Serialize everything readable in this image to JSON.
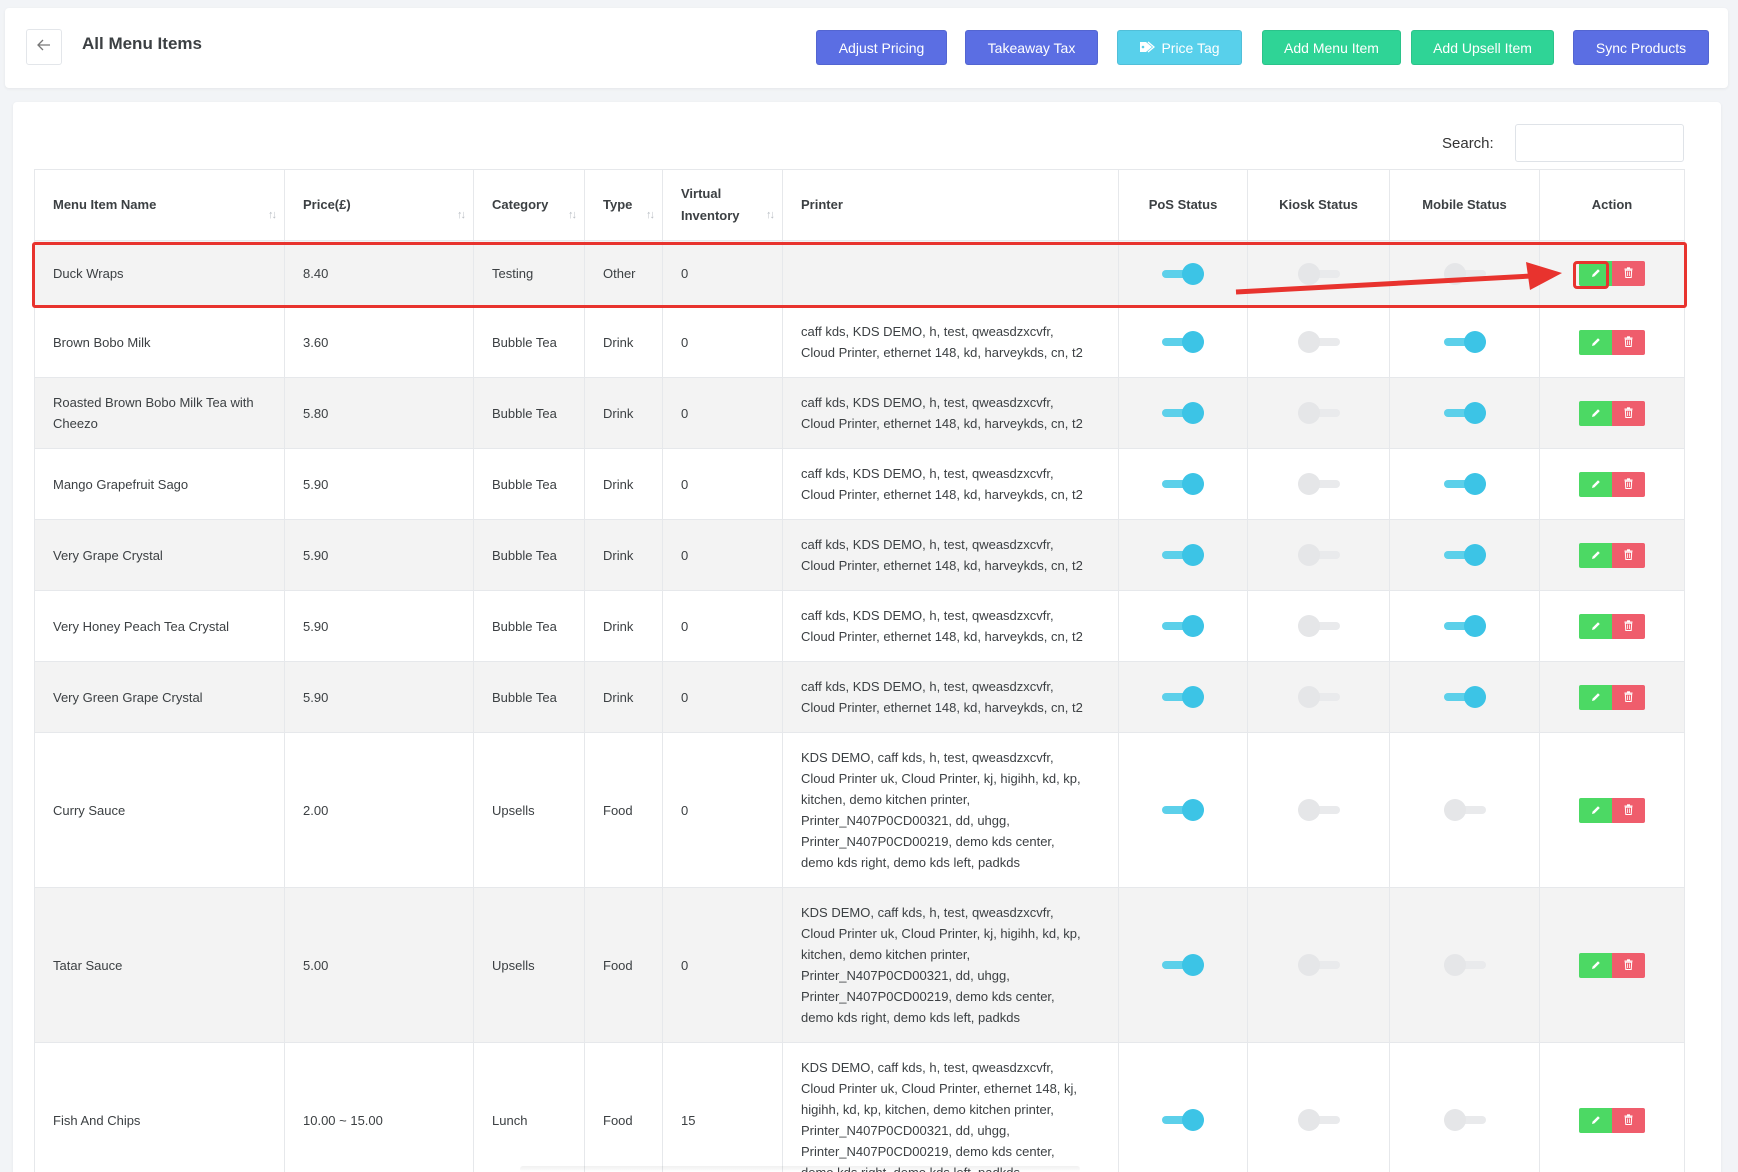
{
  "header": {
    "title": "All Menu Items",
    "buttons": {
      "adjust_pricing": "Adjust Pricing",
      "takeaway_tax": "Takeaway Tax",
      "price_tag": "Price Tag",
      "add_menu_item": "Add Menu Item",
      "add_upsell_item": "Add Upsell Item",
      "sync_products": "Sync Products"
    }
  },
  "search": {
    "label": "Search:",
    "value": ""
  },
  "table": {
    "columns": {
      "name": "Menu Item Name",
      "price": "Price(£)",
      "category": "Category",
      "type": "Type",
      "inventory": "Virtual Inventory",
      "printer": "Printer",
      "pos_status": "PoS Status",
      "kiosk_status": "Kiosk Status",
      "mobile_status": "Mobile Status",
      "action": "Action"
    },
    "rows": [
      {
        "name": "Duck Wraps",
        "price": "8.40",
        "category": "Testing",
        "type": "Other",
        "inventory": "0",
        "printer": [],
        "pos": true,
        "kiosk": false,
        "mobile": false
      },
      {
        "name": "Brown Bobo Milk",
        "price": "3.60",
        "category": "Bubble Tea",
        "type": "Drink",
        "inventory": "0",
        "printer": [
          "caff kds, KDS DEMO, h, test, qweasdzxcvfr,",
          "Cloud Printer, ethernet 148, kd, harveykds, cn, t2"
        ],
        "pos": true,
        "kiosk": false,
        "mobile": true
      },
      {
        "name": "Roasted Brown Bobo Milk Tea with Cheezo",
        "price": "5.80",
        "category": "Bubble Tea",
        "type": "Drink",
        "inventory": "0",
        "printer": [
          "caff kds, KDS DEMO, h, test, qweasdzxcvfr,",
          "Cloud Printer, ethernet 148, kd, harveykds, cn, t2"
        ],
        "pos": true,
        "kiosk": false,
        "mobile": true
      },
      {
        "name": "Mango Grapefruit Sago",
        "price": "5.90",
        "category": "Bubble Tea",
        "type": "Drink",
        "inventory": "0",
        "printer": [
          "caff kds, KDS DEMO, h, test, qweasdzxcvfr,",
          "Cloud Printer, ethernet 148, kd, harveykds, cn, t2"
        ],
        "pos": true,
        "kiosk": false,
        "mobile": true
      },
      {
        "name": "Very Grape Crystal",
        "price": "5.90",
        "category": "Bubble Tea",
        "type": "Drink",
        "inventory": "0",
        "printer": [
          "caff kds, KDS DEMO, h, test, qweasdzxcvfr,",
          "Cloud Printer, ethernet 148, kd, harveykds, cn, t2"
        ],
        "pos": true,
        "kiosk": false,
        "mobile": true
      },
      {
        "name": "Very Honey Peach Tea Crystal",
        "price": "5.90",
        "category": "Bubble Tea",
        "type": "Drink",
        "inventory": "0",
        "printer": [
          "caff kds, KDS DEMO, h, test, qweasdzxcvfr,",
          "Cloud Printer, ethernet 148, kd, harveykds, cn, t2"
        ],
        "pos": true,
        "kiosk": false,
        "mobile": true
      },
      {
        "name": "Very Green Grape Crystal",
        "price": "5.90",
        "category": "Bubble Tea",
        "type": "Drink",
        "inventory": "0",
        "printer": [
          "caff kds, KDS DEMO, h, test, qweasdzxcvfr,",
          "Cloud Printer, ethernet 148, kd, harveykds, cn, t2"
        ],
        "pos": true,
        "kiosk": false,
        "mobile": true
      },
      {
        "name": "Curry Sauce",
        "price": "2.00",
        "category": "Upsells",
        "type": "Food",
        "inventory": "0",
        "printer": [
          "KDS DEMO, caff kds, h, test, qweasdzxcvfr,",
          "Cloud Printer uk, Cloud Printer, kj, higihh, kd, kp,",
          "kitchen, demo kitchen printer,",
          "Printer_N407P0CD00321, dd, uhgg,",
          "Printer_N407P0CD00219, demo kds center,",
          "demo kds right, demo kds left, padkds"
        ],
        "pos": true,
        "kiosk": false,
        "mobile": false
      },
      {
        "name": "Tatar Sauce",
        "price": "5.00",
        "category": "Upsells",
        "type": "Food",
        "inventory": "0",
        "printer": [
          "KDS DEMO, caff kds, h, test, qweasdzxcvfr,",
          "Cloud Printer uk, Cloud Printer, kj, higihh, kd, kp,",
          "kitchen, demo kitchen printer,",
          "Printer_N407P0CD00321, dd, uhgg,",
          "Printer_N407P0CD00219, demo kds center,",
          "demo kds right, demo kds left, padkds"
        ],
        "pos": true,
        "kiosk": false,
        "mobile": false
      },
      {
        "name": "Fish And Chips",
        "price": "10.00 ~ 15.00",
        "category": "Lunch",
        "type": "Food",
        "inventory": "15",
        "printer": [
          "KDS DEMO, caff kds, h, test, qweasdzxcvfr,",
          "Cloud Printer uk, Cloud Printer, ethernet 148, kj,",
          "higihh, kd, kp, kitchen, demo kitchen printer,",
          "Printer_N407P0CD00321, dd, uhgg,",
          "Printer_N407P0CD00219, demo kds center,",
          "demo kds right, demo kds left, padkds"
        ],
        "pos": true,
        "kiosk": false,
        "mobile": false
      }
    ]
  },
  "icons": {
    "back": "arrow-left-icon",
    "price_tag": "tags-icon",
    "edit": "pencil-icon",
    "delete": "trash-icon",
    "sort": "sort-arrows-icon"
  },
  "colors": {
    "primary": "#5b6ee3",
    "info": "#58d0eb",
    "success": "#2fd496",
    "toggle_on": "#3cc4e6",
    "edit": "#4cd964",
    "delete": "#ef5d6c",
    "annotation": "#e8332e"
  }
}
